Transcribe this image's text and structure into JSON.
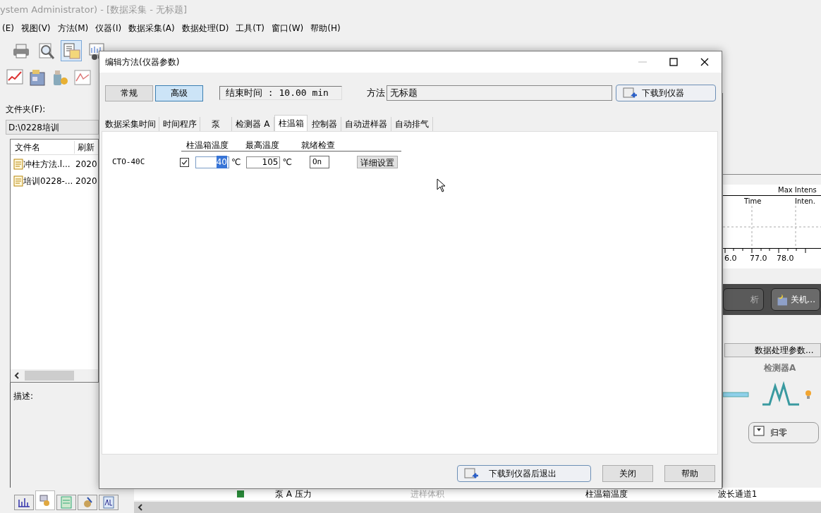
{
  "app": {
    "title": "ystem Administrator) - [数据采集 - 无标题]",
    "menu": [
      "(E)",
      "视图(V)",
      "方法(M)",
      "仪器(I)",
      "数据采集(A)",
      "数据处理(D)",
      "工具(T)",
      "窗口(W)",
      "帮助(H)"
    ]
  },
  "file_panel": {
    "folder_label": "文件夹(F):",
    "path": "D:\\0228培训",
    "columns": [
      "文件名",
      "刷新"
    ],
    "rows": [
      {
        "name": "冲柱方法.l...",
        "date": "2020"
      },
      {
        "name": "培训0228-...",
        "date": "2020"
      }
    ],
    "description_label": "描述:",
    "bottom_tabs": [
      {
        "selected": false
      },
      {
        "selected": true
      },
      {
        "selected": false
      },
      {
        "selected": false
      },
      {
        "selected": false
      }
    ]
  },
  "monitor": {
    "chart_header": "Max Intens",
    "columns": [
      "Time",
      "Inten."
    ],
    "ticks": [
      "6.0",
      "77.0",
      "78.0"
    ],
    "buttons": [
      {
        "label": "析",
        "disabled": true
      },
      {
        "label": "关机...",
        "disabled": false
      }
    ],
    "data_processing_button": "数据处理参数...",
    "detector_label": "检测器A",
    "zero_button": "归零"
  },
  "status_strip": [
    "泵 A 压力",
    "进样体积",
    "柱温箱温度",
    "波长通道1"
  ],
  "dialog": {
    "title": "编辑方法(仪器参数)",
    "modes": [
      {
        "label": "常规",
        "selected": false
      },
      {
        "label": "高级",
        "selected": true
      }
    ],
    "end_time": "结束时间 : 10.00 min",
    "method_label": "方法",
    "method_name": "无标题",
    "download_button": "下载到仪器",
    "tabs": [
      {
        "label": "数据采集时间",
        "selected": false
      },
      {
        "label": "时间程序",
        "selected": false
      },
      {
        "label": "泵",
        "selected": false
      },
      {
        "label": "检测器 A",
        "selected": false
      },
      {
        "label": "柱温箱",
        "selected": true
      },
      {
        "label": "控制器",
        "selected": false
      },
      {
        "label": "自动进样器",
        "selected": false
      },
      {
        "label": "自动排气",
        "selected": false
      }
    ],
    "oven": {
      "headers": [
        "柱温箱温度",
        "最高温度",
        "就绪检查"
      ],
      "rows": [
        {
          "name": "CTO-40C",
          "checked": true,
          "temp": "40",
          "temp_selected": true,
          "temp_unit": "℃",
          "max_temp": "105",
          "max_unit": "℃",
          "ready_check": "On",
          "detail_button": "详细设置"
        }
      ]
    },
    "buttons": [
      "下载到仪器后退出",
      "关闭",
      "帮助"
    ]
  }
}
